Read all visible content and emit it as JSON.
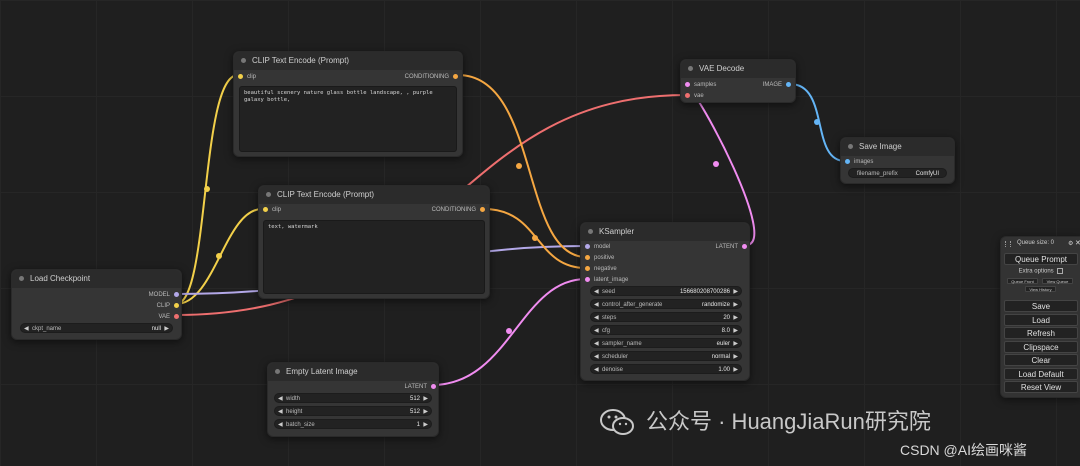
{
  "nodes": {
    "clip_top": {
      "title": "CLIP Text Encode (Prompt)",
      "in": "clip",
      "out": "CONDITIONING",
      "text": "beautiful scenery nature glass bottle landscape, , purple galaxy bottle,"
    },
    "clip_mid": {
      "title": "CLIP Text Encode (Prompt)",
      "in": "clip",
      "out": "CONDITIONING",
      "text": "text, watermark"
    },
    "vae_decode": {
      "title": "VAE Decode",
      "in_samples": "samples",
      "in_vae": "vae",
      "out": "IMAGE"
    },
    "save_image": {
      "title": "Save Image",
      "in": "images",
      "prefix_label": "filename_prefix",
      "prefix_value": "ComfyUI"
    },
    "load_checkpoint": {
      "title": "Load Checkpoint",
      "out_model": "MODEL",
      "out_clip": "CLIP",
      "out_vae": "VAE",
      "ckpt_label": "ckpt_name",
      "ckpt_value": "null"
    },
    "ksampler": {
      "title": "KSampler",
      "in_model": "model",
      "in_positive": "positive",
      "in_negative": "negative",
      "in_latent": "latent_image",
      "out": "LATENT",
      "widgets": [
        {
          "label": "seed",
          "value": "156680208700286"
        },
        {
          "label": "control_after_generate",
          "value": "randomize"
        },
        {
          "label": "steps",
          "value": "20"
        },
        {
          "label": "cfg",
          "value": "8.0"
        },
        {
          "label": "sampler_name",
          "value": "euler"
        },
        {
          "label": "scheduler",
          "value": "normal"
        },
        {
          "label": "denoise",
          "value": "1.00"
        }
      ]
    },
    "empty_latent": {
      "title": "Empty Latent Image",
      "out": "LATENT",
      "widgets": [
        {
          "label": "width",
          "value": "512"
        },
        {
          "label": "height",
          "value": "512"
        },
        {
          "label": "batch_size",
          "value": "1"
        }
      ]
    }
  },
  "menu": {
    "queue_size": "Queue size: 0",
    "queue_prompt": "Queue Prompt",
    "extra_options": "Extra options",
    "queue_front": "Queue Front",
    "view_queue": "View Queue",
    "view_history": "View History",
    "save": "Save",
    "load": "Load",
    "refresh": "Refresh",
    "clipspace": "Clipspace",
    "clear": "Clear",
    "load_default": "Load Default",
    "reset_view": "Reset View"
  },
  "watermark": {
    "text": "公众号 · HuangJiaRun研究院",
    "credit": "CSDN @AI绘画咪酱"
  },
  "colors": {
    "clip": "#f2d04a",
    "model": "#b3a8e8",
    "vae": "#ee6f6f",
    "conditioning": "#f5a742",
    "latent": "#f08cf0",
    "image": "#64b5f6"
  }
}
